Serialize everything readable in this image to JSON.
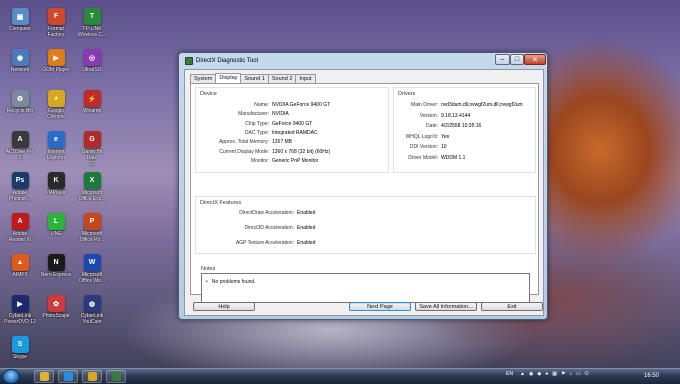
{
  "desktop": {
    "icons": [
      {
        "label": "Computer",
        "color": "#5a8ac8",
        "glyph": "▣",
        "icon": "computer-icon"
      },
      {
        "label": "Format\nFactory",
        "color": "#d04a2a",
        "glyph": "F",
        "icon": "format-factory-icon"
      },
      {
        "label": "TP-LINK\nWireless C...",
        "color": "#2a8a3a",
        "glyph": "T",
        "icon": "tplink-icon"
      },
      {
        "label": "Network",
        "color": "#4a7ab8",
        "glyph": "◉",
        "icon": "network-icon"
      },
      {
        "label": "GOM Player",
        "color": "#e07a1a",
        "glyph": "▶",
        "icon": "gom-player-icon"
      },
      {
        "label": "UltraISO",
        "color": "#8a3ab0",
        "glyph": "◎",
        "icon": "ultraiso-icon"
      },
      {
        "label": "Recycle Bin",
        "color": "#7a8a9a",
        "glyph": "♻",
        "icon": "recycle-bin-icon"
      },
      {
        "label": "Google\nChrome",
        "color": "#d8a820",
        "glyph": "◕",
        "icon": "chrome-icon"
      },
      {
        "label": "Winamp",
        "color": "#c02a2a",
        "glyph": "⚡",
        "icon": "winamp-icon"
      },
      {
        "label": "ACDSee Pro\n3",
        "color": "#3a3a3a",
        "glyph": "A",
        "icon": "acdsee-icon"
      },
      {
        "label": "Internet\nExplorer",
        "color": "#2a6ac8",
        "glyph": "e",
        "icon": "ie-icon"
      },
      {
        "label": "Game Bit\nRate\nL2",
        "color": "#b02a2a",
        "glyph": "G",
        "icon": "game-icon"
      },
      {
        "label": "Adobe\nPhotosh...",
        "color": "#1a3a6a",
        "glyph": "Ps",
        "icon": "photoshop-icon"
      },
      {
        "label": "KMPlayer",
        "color": "#2a2a2a",
        "glyph": "K",
        "icon": "kmplayer-icon"
      },
      {
        "label": "Microsoft\nOffice Exc...",
        "color": "#1e7a3a",
        "glyph": "X",
        "icon": "excel-icon"
      },
      {
        "label": "Adobe\nReader XI",
        "color": "#c01a1a",
        "glyph": "A",
        "icon": "adobe-reader-icon"
      },
      {
        "label": "LINE",
        "color": "#2ab53a",
        "glyph": "L",
        "icon": "line-icon"
      },
      {
        "label": "Microsoft\nOffice Po...",
        "color": "#c8471a",
        "glyph": "P",
        "icon": "powerpoint-icon"
      },
      {
        "label": "AIMP3",
        "color": "#e05a1a",
        "glyph": "▲",
        "icon": "aimp-icon"
      },
      {
        "label": "Nero Express",
        "color": "#1a1a1a",
        "glyph": "N",
        "icon": "nero-icon"
      },
      {
        "label": "Microsoft\nOffice Wo...",
        "color": "#1a4ab0",
        "glyph": "W",
        "icon": "word-icon"
      },
      {
        "label": "CyberLink\nPowerDVD 12",
        "color": "#1a2a6a",
        "glyph": "▶",
        "icon": "powerdvd-icon"
      },
      {
        "label": "PhotoScape",
        "color": "#d03a3a",
        "glyph": "✿",
        "icon": "photoscape-icon"
      },
      {
        "label": "CyberLink\nYouCam",
        "color": "#2a3a7a",
        "glyph": "◍",
        "icon": "youcam-icon"
      },
      {
        "label": "Skype",
        "color": "#1a9ae0",
        "glyph": "S",
        "icon": "skype-icon"
      }
    ]
  },
  "window": {
    "title": "DirectX Diagnostic Tool",
    "tabs": [
      "System",
      "Display",
      "Sound 1",
      "Sound 2",
      "Input"
    ],
    "selected_tab": "Display",
    "device": {
      "heading": "Device",
      "rows": [
        {
          "label": "Name:",
          "value": "NVIDIA GeForce 9400 GT"
        },
        {
          "label": "Manufacturer:",
          "value": "NVIDIA"
        },
        {
          "label": "Chip Type:",
          "value": "GeForce 9400 GT"
        },
        {
          "label": "DAC Type:",
          "value": "Integrated RAMDAC"
        },
        {
          "label": "Approx. Total Memory:",
          "value": "1267 MB"
        },
        {
          "label": "Current Display Mode:",
          "value": "1360 x 768 (32 bit) (60Hz)"
        },
        {
          "label": "Monitor:",
          "value": "Generic PnP Monitor"
        }
      ]
    },
    "drivers": {
      "heading": "Drivers",
      "rows": [
        {
          "label": "Main Driver:",
          "value": "nvd3dum.dll,nvwgf2um.dll,nvwgf2um"
        },
        {
          "label": "Version:",
          "value": "9.18.13.4144"
        },
        {
          "label": "Date:",
          "value": "4/2/2558 10:35:16"
        },
        {
          "label": "WHQL Logo'd:",
          "value": "Yes"
        },
        {
          "label": "DDI Version:",
          "value": "10"
        },
        {
          "label": "Driver Model:",
          "value": "WDDM 1.1"
        }
      ]
    },
    "features": {
      "heading": "DirectX Features",
      "rows": [
        {
          "label": "DirectDraw Acceleration:",
          "value": "Enabled"
        },
        {
          "label": "Direct3D Acceleration:",
          "value": "Enabled"
        },
        {
          "label": "AGP Texture Acceleration:",
          "value": "Enabled"
        }
      ]
    },
    "notes": {
      "heading": "Notes",
      "bullet": "No problems found."
    },
    "buttons": {
      "help": "Help",
      "next": "Next Page",
      "save": "Save All Information...",
      "exit": "Exit"
    }
  },
  "taskbar": {
    "lang": "EN",
    "clock": "16:50",
    "pinned": [
      {
        "icon": "explorer-icon",
        "color": "#e0b030"
      },
      {
        "icon": "media-player-icon",
        "color": "#2a8ae0"
      },
      {
        "icon": "chrome-icon",
        "color": "#d8a820"
      },
      {
        "icon": "dxdiag-icon",
        "color": "#3a7a3a"
      }
    ]
  }
}
